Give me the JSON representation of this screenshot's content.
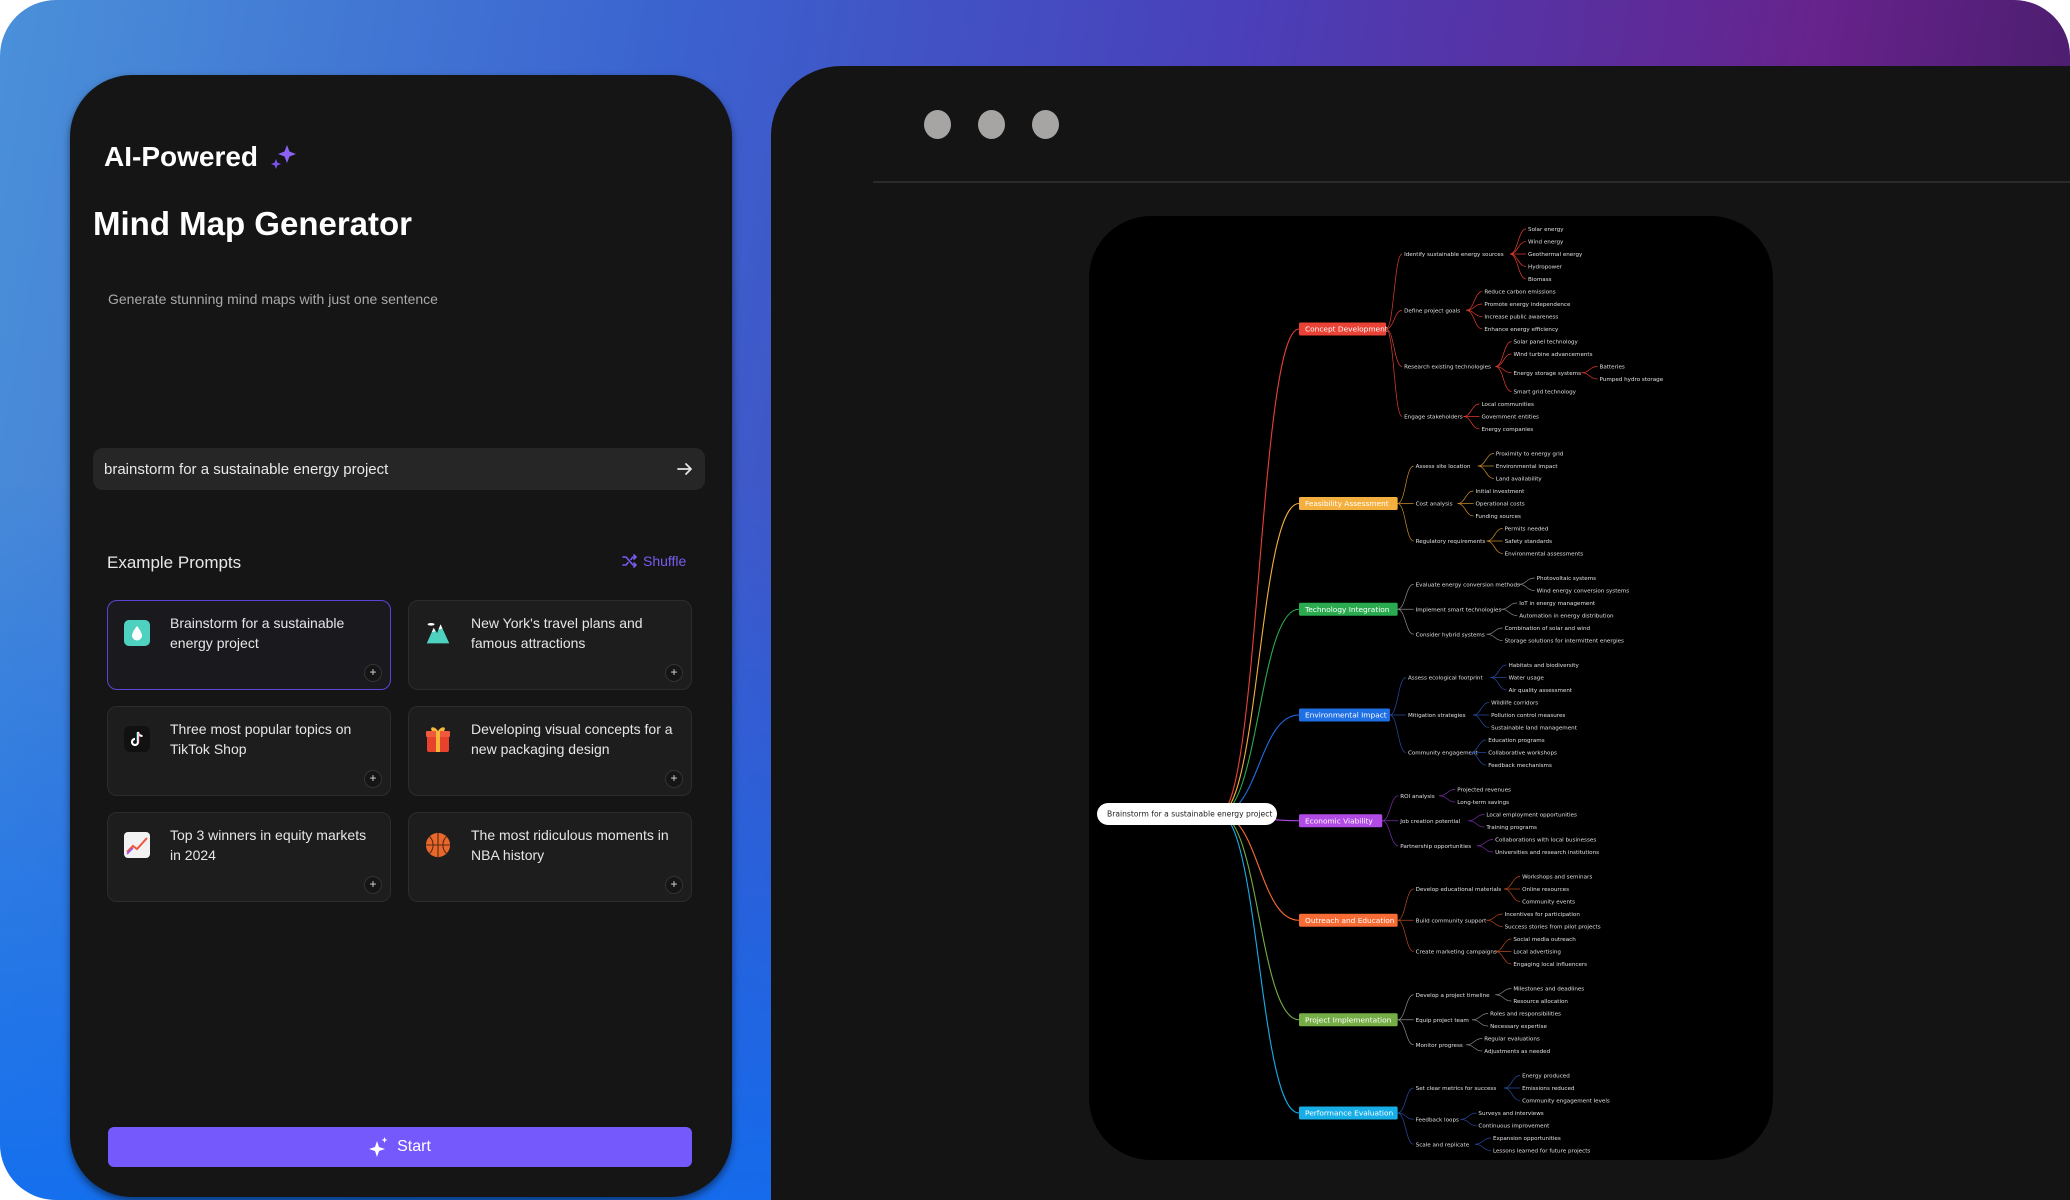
{
  "left_panel": {
    "brand": "AI-Powered",
    "title": "Mind Map Generator",
    "subtitle": "Generate stunning mind maps with just one sentence",
    "input_value": "brainstorm for a sustainable energy project",
    "examples_heading": "Example Prompts",
    "shuffle_label": "Shuffle",
    "examples": [
      {
        "icon": "water-drop-icon",
        "label": "Brainstorm for a sustainable energy project",
        "active": true
      },
      {
        "icon": "mountain-icon",
        "label": "New York's travel plans and famous attractions",
        "active": false
      },
      {
        "icon": "tiktok-icon",
        "label": "Three most popular topics on TikTok Shop",
        "active": false
      },
      {
        "icon": "gift-icon",
        "label": "Developing visual concepts for a new packaging design",
        "active": false
      },
      {
        "icon": "chart-up-icon",
        "label": "Top 3 winners in equity markets in 2024",
        "active": false
      },
      {
        "icon": "basketball-icon",
        "label": "The most ridiculous moments in NBA history",
        "active": false
      }
    ],
    "start_label": "Start",
    "accent": "#7659fc"
  },
  "window": {
    "controls": [
      "window-dot-1",
      "window-dot-2",
      "window-dot-3"
    ]
  },
  "mindmap": {
    "root": "Brainstorm for a sustainable energy project",
    "branches": [
      {
        "label": "Concept Development",
        "color": "#ea4235",
        "line": "#e23d2f",
        "children": [
          {
            "label": "Identify sustainable energy sources",
            "children": [
              {
                "label": "Solar energy"
              },
              {
                "label": "Wind energy"
              },
              {
                "label": "Geothermal energy"
              },
              {
                "label": "Hydropower"
              },
              {
                "label": "Biomass"
              }
            ]
          },
          {
            "label": "Define project goals",
            "children": [
              {
                "label": "Reduce carbon emissions"
              },
              {
                "label": "Promote energy independence"
              },
              {
                "label": "Increase public awareness"
              },
              {
                "label": "Enhance energy efficiency"
              }
            ]
          },
          {
            "label": "Research existing technologies",
            "children": [
              {
                "label": "Solar panel technology"
              },
              {
                "label": "Wind turbine advancements"
              },
              {
                "label": "Energy storage systems",
                "children": [
                  {
                    "label": "Batteries"
                  },
                  {
                    "label": "Pumped hydro storage"
                  }
                ]
              },
              {
                "label": "Smart grid technology"
              }
            ]
          },
          {
            "label": "Engage stakeholders",
            "children": [
              {
                "label": "Local communities"
              },
              {
                "label": "Government entities"
              },
              {
                "label": "Energy companies"
              }
            ]
          }
        ]
      },
      {
        "label": "Feasibility Assessment",
        "color": "#f4b03e",
        "line": "#c98a2c",
        "children": [
          {
            "label": "Assess site location",
            "children": [
              {
                "label": "Proximity to energy grid"
              },
              {
                "label": "Environmental impact"
              },
              {
                "label": "Land availability"
              }
            ]
          },
          {
            "label": "Cost analysis",
            "children": [
              {
                "label": "Initial investment"
              },
              {
                "label": "Operational costs"
              },
              {
                "label": "Funding sources"
              }
            ]
          },
          {
            "label": "Regulatory requirements",
            "children": [
              {
                "label": "Permits needed"
              },
              {
                "label": "Safety standards"
              },
              {
                "label": "Environmental assessments"
              }
            ]
          }
        ]
      },
      {
        "label": "Technology Integration",
        "color": "#2bab4f",
        "line": "#8a8a8a",
        "children": [
          {
            "label": "Evaluate energy conversion methods",
            "children": [
              {
                "label": "Photovoltaic systems"
              },
              {
                "label": "Wind energy conversion systems"
              }
            ]
          },
          {
            "label": "Implement smart technologies",
            "children": [
              {
                "label": "IoT in energy management"
              },
              {
                "label": "Automation in energy distribution"
              }
            ]
          },
          {
            "label": "Consider hybrid systems",
            "children": [
              {
                "label": "Combination of solar and wind"
              },
              {
                "label": "Storage solutions for intermittent energies"
              }
            ]
          }
        ]
      },
      {
        "label": "Environmental Impact",
        "color": "#1f6fe5",
        "line": "#2a4a9e",
        "children": [
          {
            "label": "Assess ecological footprint",
            "children": [
              {
                "label": "Habitats and biodiversity"
              },
              {
                "label": "Water usage"
              },
              {
                "label": "Air quality assessment"
              }
            ]
          },
          {
            "label": "Mitigation strategies",
            "children": [
              {
                "label": "Wildlife corridors"
              },
              {
                "label": "Pollution control measures"
              },
              {
                "label": "Sustainable land management"
              }
            ]
          },
          {
            "label": "Community engagement",
            "children": [
              {
                "label": "Education programs"
              },
              {
                "label": "Collaborative workshops"
              },
              {
                "label": "Feedback mechanisms"
              }
            ]
          }
        ]
      },
      {
        "label": "Economic Viability",
        "color": "#b24ae6",
        "line": "#7a2fa8",
        "children": [
          {
            "label": "ROI analysis",
            "children": [
              {
                "label": "Projected revenues"
              },
              {
                "label": "Long-term savings"
              }
            ]
          },
          {
            "label": "Job creation potential",
            "children": [
              {
                "label": "Local employment opportunities"
              },
              {
                "label": "Training programs"
              }
            ]
          },
          {
            "label": "Partnership opportunities",
            "children": [
              {
                "label": "Collaborations with local businesses"
              },
              {
                "label": "Universities and research institutions"
              }
            ]
          }
        ]
      },
      {
        "label": "Outreach and Education",
        "color": "#f76b35",
        "line": "#b5481f",
        "children": [
          {
            "label": "Develop educational materials",
            "children": [
              {
                "label": "Workshops and seminars"
              },
              {
                "label": "Online resources"
              },
              {
                "label": "Community events"
              }
            ]
          },
          {
            "label": "Build community support",
            "children": [
              {
                "label": "Incentives for participation"
              },
              {
                "label": "Success stories from pilot projects"
              }
            ]
          },
          {
            "label": "Create marketing campaigns",
            "children": [
              {
                "label": "Social media outreach"
              },
              {
                "label": "Local advertising"
              },
              {
                "label": "Engaging local influencers"
              }
            ]
          }
        ]
      },
      {
        "label": "Project Implementation",
        "color": "#76ad46",
        "line": "#8a8a8a",
        "children": [
          {
            "label": "Develop a project timeline",
            "children": [
              {
                "label": "Milestones and deadlines"
              },
              {
                "label": "Resource allocation"
              }
            ]
          },
          {
            "label": "Equip project team",
            "children": [
              {
                "label": "Roles and responsibilities"
              },
              {
                "label": "Necessary expertise"
              }
            ]
          },
          {
            "label": "Monitor progress",
            "children": [
              {
                "label": "Regular evaluations"
              },
              {
                "label": "Adjustments as needed"
              }
            ]
          }
        ]
      },
      {
        "label": "Performance Evaluation",
        "color": "#17aee8",
        "line": "#2a4a9e",
        "children": [
          {
            "label": "Set clear metrics for success",
            "children": [
              {
                "label": "Energy produced"
              },
              {
                "label": "Emissions reduced"
              },
              {
                "label": "Community engagement levels"
              }
            ]
          },
          {
            "label": "Feedback loops",
            "children": [
              {
                "label": "Surveys and interviews"
              },
              {
                "label": "Continuous improvement"
              }
            ]
          },
          {
            "label": "Scale and replicate",
            "children": [
              {
                "label": "Expansion opportunities"
              },
              {
                "label": "Lessons learned for future projects"
              }
            ]
          }
        ]
      }
    ]
  }
}
